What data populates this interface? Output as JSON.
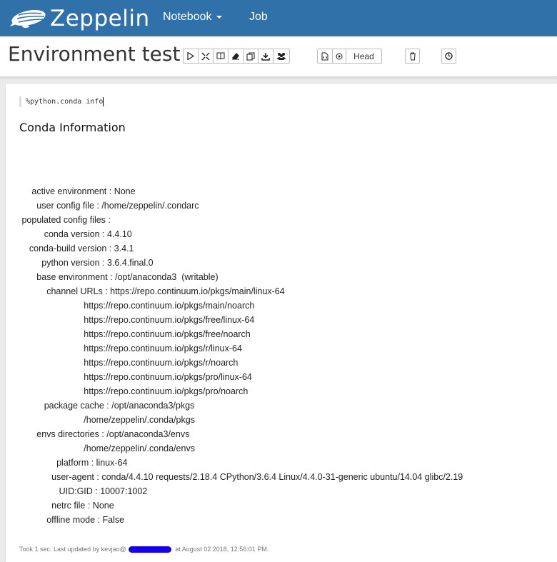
{
  "navbar": {
    "brand": "Zeppelin",
    "menu": [
      {
        "label": "Notebook",
        "has_caret": true
      },
      {
        "label": "Job",
        "has_caret": false
      }
    ]
  },
  "notebook": {
    "title": "Environment test",
    "toolbar": {
      "run_all_icon": "play-icon",
      "toggle_code_icon": "expand-icon",
      "toggle_output_icon": "book-icon",
      "clear_output_icon": "eraser-icon",
      "clone_icon": "copy-icon",
      "export_icon": "download-icon",
      "collaboration_icon": "users-icon",
      "version_label": "Head",
      "delete_icon": "trash-icon",
      "scheduler_icon": "clock-icon"
    }
  },
  "paragraph": {
    "code": "%python.conda info",
    "result_title": "Conda Information",
    "result_lines": [
      "     active environment : None",
      "       user config file : /home/zeppelin/.condarc",
      " populated config files : ",
      "          conda version : 4.4.10",
      "    conda-build version : 3.4.1",
      "         python version : 3.6.4.final.0",
      "       base environment : /opt/anaconda3  (writable)",
      "           channel URLs : https://repo.continuum.io/pkgs/main/linux-64",
      "                          https://repo.continuum.io/pkgs/main/noarch",
      "                          https://repo.continuum.io/pkgs/free/linux-64",
      "                          https://repo.continuum.io/pkgs/free/noarch",
      "                          https://repo.continuum.io/pkgs/r/linux-64",
      "                          https://repo.continuum.io/pkgs/r/noarch",
      "                          https://repo.continuum.io/pkgs/pro/linux-64",
      "                          https://repo.continuum.io/pkgs/pro/noarch",
      "          package cache : /opt/anaconda3/pkgs",
      "                          /home/zeppelin/.conda/pkgs",
      "       envs directories : /opt/anaconda3/envs",
      "                          /home/zeppelin/.conda/envs",
      "               platform : linux-64",
      "             user-agent : conda/4.4.10 requests/2.18.4 CPython/3.6.4 Linux/4.4.0-31-generic ubuntu/14.04 glibc/2.19",
      "                UID:GID : 10007:1002",
      "             netrc file : None",
      "           offline mode : False"
    ],
    "footer_prefix": "Took 1 sec. Last updated by kevjao@",
    "footer_suffix": " at August 02 2018, 12:56:01 PM."
  },
  "colors": {
    "navbar": "#3071a9",
    "redaction": "#1400f0"
  }
}
